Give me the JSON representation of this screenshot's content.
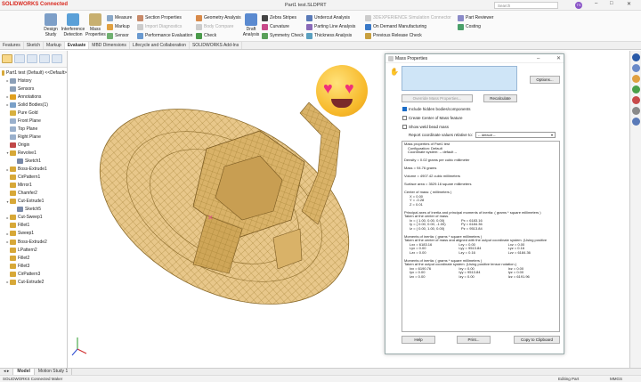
{
  "app": {
    "brand": "SOLIDWORKS Connected",
    "file_title": "Part1 test.SLDPRT"
  },
  "titlebar": {
    "search_placeholder": "Search",
    "avatar_initials": "TS",
    "min": "–",
    "max": "□",
    "close": "✕"
  },
  "ribbon": {
    "design_study": "Design Study",
    "interference_detection": "Interference Detection",
    "mass_properties": "Mass Properties",
    "col1": [
      "Measure",
      "Markup",
      "Sensor"
    ],
    "col2": [
      "Section Properties",
      "Import Diagnostics",
      "Performance Evaluation"
    ],
    "col3": [
      "Geometry Analysis",
      "Body Compare",
      "Check"
    ],
    "draft_analysis": "Draft Analysis",
    "col4": [
      "Zebra Stripes",
      "Curvature",
      "Symmetry Check"
    ],
    "col5": [
      "Undercut Analysis",
      "Parting Line Analysis",
      "Thickness Analysis"
    ],
    "col6": [
      "3DEXPERIENCE Simulation Connector",
      "On Demand Manufacturing",
      "Previous Release Check"
    ],
    "col7": [
      "Part Reviewer",
      "Costing"
    ]
  },
  "tabs": [
    "Features",
    "Sketch",
    "Markup",
    "Evaluate",
    "MBD Dimensions",
    "Lifecycle and Collaboration",
    "SOLIDWORKS Add-Ins"
  ],
  "active_tab": "Evaluate",
  "tree": [
    {
      "label": "Part1 test (Default) <<Default>",
      "exp": "",
      "color": "#d7a838"
    },
    {
      "label": "History",
      "exp": "▸",
      "color": "#8ca0b8"
    },
    {
      "label": "Sensors",
      "exp": "",
      "color": "#8ca0b8"
    },
    {
      "label": "Annotations",
      "exp": "▸",
      "color": "#e0a020"
    },
    {
      "label": "Solid Bodies(1)",
      "exp": "▸",
      "color": "#7aa0c8"
    },
    {
      "label": "Pure Gold",
      "exp": "",
      "color": "#d7b040"
    },
    {
      "label": "Front Plane",
      "exp": "",
      "color": "#9ab0cc"
    },
    {
      "label": "Top Plane",
      "exp": "",
      "color": "#9ab0cc"
    },
    {
      "label": "Right Plane",
      "exp": "",
      "color": "#9ab0cc"
    },
    {
      "label": "Origin",
      "exp": "",
      "color": "#c04848"
    },
    {
      "label": "Revolve1",
      "exp": "▾",
      "color": "#d7a838"
    },
    {
      "label": "Sketch1",
      "exp": "",
      "color": "#7a8aa8"
    },
    {
      "label": "Boss-Extrude1",
      "exp": "▸",
      "color": "#d7a838"
    },
    {
      "label": "CirPattern1",
      "exp": "",
      "color": "#d7a838"
    },
    {
      "label": "Mirror1",
      "exp": "",
      "color": "#d7a838"
    },
    {
      "label": "Chamfer2",
      "exp": "",
      "color": "#d7a838"
    },
    {
      "label": "Cut-Extrude1",
      "exp": "▾",
      "color": "#d7a838"
    },
    {
      "label": "Sketch5",
      "exp": "",
      "color": "#7a8aa8"
    },
    {
      "label": "Cut-Sweep1",
      "exp": "▸",
      "color": "#d7a838"
    },
    {
      "label": "Fillet1",
      "exp": "",
      "color": "#d7a838"
    },
    {
      "label": "Sweep1",
      "exp": "▸",
      "color": "#d7a838"
    },
    {
      "label": "Boss-Extrude2",
      "exp": "▸",
      "color": "#d7a838"
    },
    {
      "label": "LPattern2",
      "exp": "",
      "color": "#d7a838"
    },
    {
      "label": "Fillet2",
      "exp": "",
      "color": "#d7a838"
    },
    {
      "label": "Fillet3",
      "exp": "",
      "color": "#d7a838"
    },
    {
      "label": "CirPattern3",
      "exp": "",
      "color": "#d7a838"
    },
    {
      "label": "Cut-Extrude2",
      "exp": "▸",
      "color": "#d7a838"
    }
  ],
  "dialog": {
    "title": "Mass Properties",
    "options": "Options...",
    "override": "Override Mass Properties...",
    "recalculate": "Recalculate",
    "include_hidden": "Include hidden bodies/components",
    "create_com": "Create Center of Mass feature",
    "show_weld": "Show weld bead mass",
    "report_label": "Report coordinate values relative to:",
    "report_value": "-- default --",
    "help": "Help",
    "print": "Print...",
    "copy": "Copy to Clipboard",
    "results": {
      "header": "Mass properties of Part1 test",
      "config": "Configuration: Default",
      "coord": "Coordinate system: -- default --",
      "density": "Density = 0.02 grams per cubic millimeter",
      "mass": "Mass = 94.76 grams",
      "volume": "Volume = 4907.42 cubic millimeters",
      "surface": "Surface area = 3529.16 square millimeters",
      "com_header": "Center of mass: ( millimeters )",
      "com": [
        "X = 0.00",
        "Y = -0.28",
        "Z = 0.01"
      ],
      "principal_header": "Principal axes of inertia and principal moments of inertia: ( grams * square millimeters )",
      "principal_sub": "Taken at the center of mass.",
      "principal": [
        [
          "Ix = ( 1.00, 0.00, 0.00)",
          "Px = 6183.16"
        ],
        [
          "Iy = ( 0.00, 0.00, -1.00)",
          "Py = 6184.36"
        ],
        [
          "Iz = ( 0.00, 1.00, 0.00)",
          "Pz = 9513.84"
        ]
      ],
      "moi_header": "Moments of inertia: ( grams * square millimeters )",
      "moi_sub": "Taken at the center of mass and aligned with the output coordinate system. (Using positive",
      "moi": [
        [
          "Lxx = 6183.16",
          "Lxy = 0.00",
          "Lxz = 0.00"
        ],
        [
          "Lyx = 0.00",
          "Lyy = 9513.84",
          "Lyz = 0.16"
        ],
        [
          "Lzx = 0.00",
          "Lzy = 0.16",
          "Lzz = 6184.36"
        ]
      ],
      "out_header": "Moments of inertia: ( grams * square millimeters )",
      "out_sub": "Taken at the output coordinate system. (Using positive tensor notation.)",
      "out": [
        [
          "Ixx = 6190.76",
          "Ixy = 0.00",
          "Ixz = 0.00"
        ],
        [
          "Iyx = 0.00",
          "Iyy = 9513.84",
          "Iyz = 0.00"
        ],
        [
          "Izx = 0.00",
          "Izy = 0.00",
          "Izz = 6191.96"
        ]
      ]
    }
  },
  "bottom_tabs": [
    "Model",
    "Motion Study 1"
  ],
  "status": {
    "left": "SOLIDWORKS Connected Maker",
    "mid": "Editing Part",
    "right": "MMGS"
  },
  "colors": {
    "gold": "#d7a838",
    "accent": "#1a6cc7",
    "brand": "#d9261c"
  }
}
